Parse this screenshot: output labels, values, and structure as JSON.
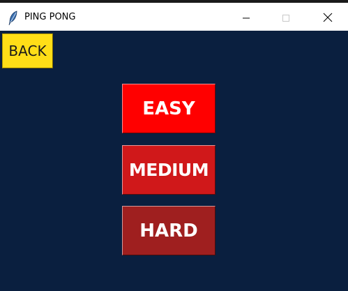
{
  "window": {
    "title": "PING PONG",
    "icon": "feather-icon",
    "controls": {
      "minimize_icon": "minimize-icon",
      "maximize_icon": "maximize-icon",
      "close_icon": "close-icon"
    }
  },
  "screen": {
    "background_color": "#0a1f3f",
    "back_button": {
      "label": "BACK",
      "color": "#ffde17"
    },
    "difficulty_buttons": [
      {
        "label": "EASY",
        "color": "#ff0000"
      },
      {
        "label": "MEDIUM",
        "color": "#d0181a"
      },
      {
        "label": "HARD",
        "color": "#9f1f1f"
      }
    ]
  }
}
